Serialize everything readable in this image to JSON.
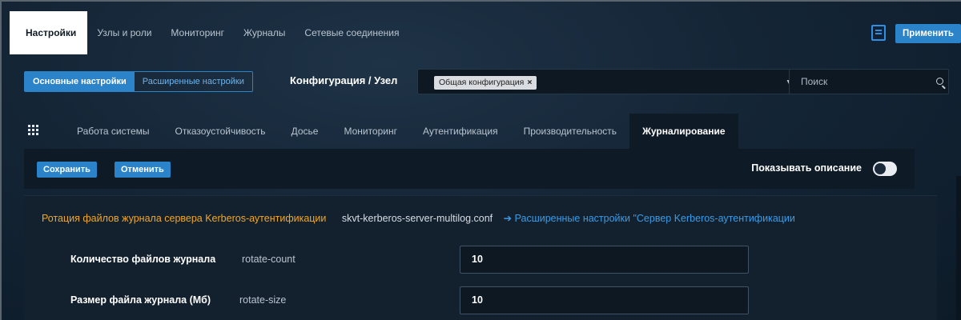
{
  "top_tabs": [
    "Настройки",
    "Узлы и роли",
    "Мониторинг",
    "Журналы",
    "Сетевые соединения"
  ],
  "apply_label": "Применить",
  "mode": {
    "basic": "Основные настройки",
    "advanced": "Расширенные настройки"
  },
  "config_label": "Конфигурация / Узел",
  "config_chip": "Общая конфигурация",
  "config_chip_close": "×",
  "caret": "▼",
  "search_placeholder": "Поиск",
  "section_tabs": [
    "Работа системы",
    "Отказоустойчивость",
    "Досье",
    "Мониторинг",
    "Аутентификация",
    "Производительность",
    "Журналирование"
  ],
  "actions": {
    "save": "Сохранить",
    "cancel": "Отменить",
    "show_description": "Показывать описание"
  },
  "rotation": {
    "title": "Ротация файлов журнала сервера Kerberos-аутентификации",
    "file": "skvt-kerberos-server-multilog.conf",
    "link": "➔ Расширенные настройки \"Сервер Kerberos-аутентификации"
  },
  "fields": [
    {
      "label": "Количество файлов журнала",
      "key": "rotate-count",
      "value": "10"
    },
    {
      "label": "Размер файла журнала (Мб)",
      "key": "rotate-size",
      "value": "10"
    }
  ],
  "colors": {
    "accent": "#2b84c9",
    "warning_title": "#f2a623",
    "link": "#3a9be6"
  }
}
